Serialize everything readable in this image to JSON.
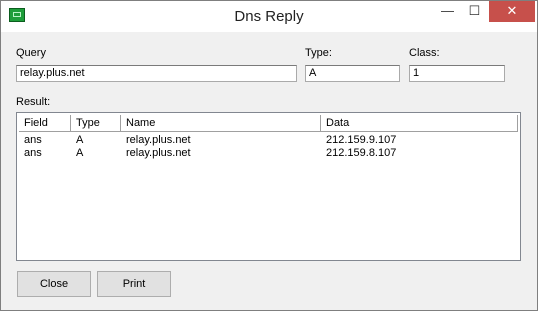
{
  "window": {
    "title": "Dns Reply",
    "controls": {
      "minimize": "—",
      "maximize": "☐",
      "close": "✕"
    }
  },
  "query": {
    "label": "Query",
    "value": "relay.plus.net"
  },
  "type": {
    "label": "Type:",
    "value": "A"
  },
  "class": {
    "label": "Class:",
    "value": "1"
  },
  "result": {
    "label": "Result:",
    "columns": [
      "Field",
      "Type",
      "Name",
      "Data"
    ],
    "rows": [
      [
        "ans",
        "A",
        "relay.plus.net",
        "212.159.9.107"
      ],
      [
        "ans",
        "A",
        "relay.plus.net",
        "212.159.8.107"
      ]
    ]
  },
  "buttons": {
    "close": "Close",
    "print": "Print"
  }
}
